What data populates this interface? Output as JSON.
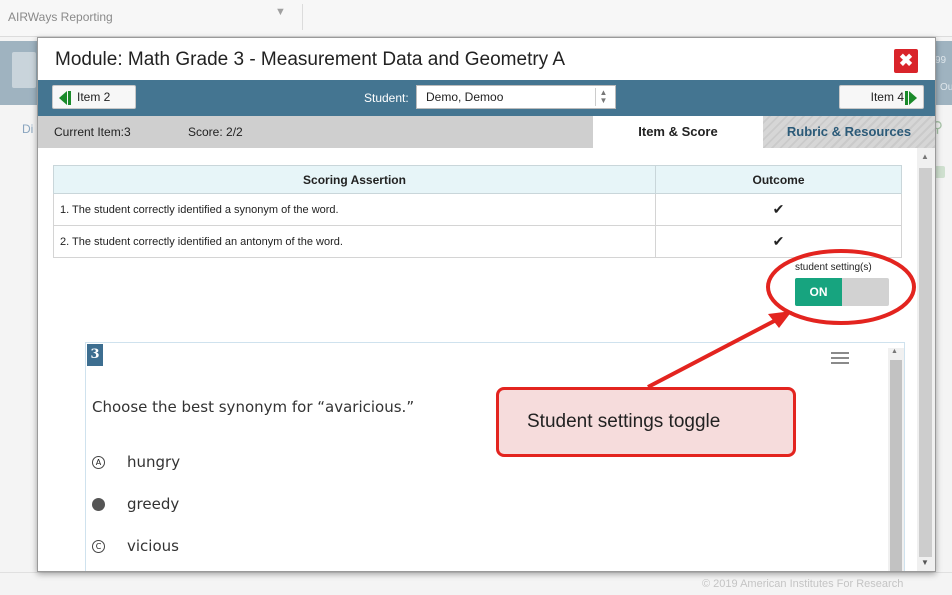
{
  "background": {
    "app_name": "AIRWays Reporting",
    "fragment_right_top": "99",
    "fragment_right_bottom": "Ou",
    "fragment_left": "Di",
    "copyright": "© 2019 American Institutes For Research"
  },
  "modal": {
    "title": "Module: Math Grade 3 - Measurement Data and Geometry A",
    "close_label": "✖",
    "nav": {
      "prev_label": "Item 2",
      "next_label": "Item 4",
      "student_label": "Student:",
      "student_value": "Demo, Demoo"
    },
    "info": {
      "current_item": "Current Item:3",
      "score": "Score: 2/2"
    },
    "tabs": {
      "item_score": "Item & Score",
      "rubric_resources": "Rubric & Resources"
    },
    "table": {
      "headers": [
        "Scoring Assertion",
        "Outcome"
      ],
      "rows": [
        {
          "assertion": "1. The student correctly identified a synonym of the word.",
          "outcome": "✔"
        },
        {
          "assertion": "2. The student correctly identified an antonym of the word.",
          "outcome": "✔"
        }
      ]
    },
    "student_settings": {
      "label": "student setting(s)",
      "toggle_state": "ON"
    },
    "item": {
      "number": "3",
      "question": "Choose the best synonym for “avaricious.”",
      "options": [
        {
          "letter": "A",
          "text": "hungry",
          "selected": false
        },
        {
          "letter": "B",
          "text": "greedy",
          "selected": true
        },
        {
          "letter": "C",
          "text": "vicious",
          "selected": false
        }
      ]
    }
  },
  "annotation": {
    "callout_text": "Student settings toggle",
    "color": "#e3241f"
  },
  "colors": {
    "nav_bar": "#447591",
    "toggle_on": "#17a47f",
    "close_button": "#d9242a",
    "nav_arrow": "#1a8a2a"
  }
}
